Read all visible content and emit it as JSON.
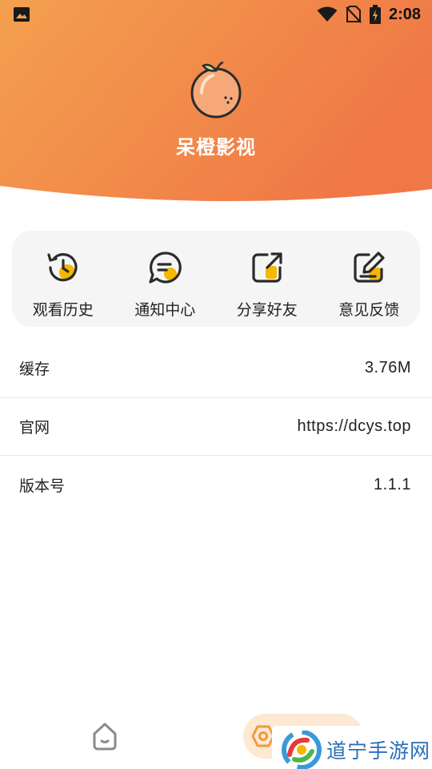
{
  "status_bar": {
    "time": "2:08",
    "icons": [
      "image-icon",
      "wifi-icon",
      "no-sim-icon",
      "battery-charging-icon"
    ]
  },
  "app": {
    "name": "呆橙影视",
    "logo_icon": "orange-fruit-icon"
  },
  "quick_actions": [
    {
      "label": "观看历史",
      "icon": "history-icon"
    },
    {
      "label": "通知中心",
      "icon": "message-icon"
    },
    {
      "label": "分享好友",
      "icon": "share-icon"
    },
    {
      "label": "意见反馈",
      "icon": "feedback-edit-icon"
    }
  ],
  "info_rows": [
    {
      "key": "缓存",
      "value": "3.76M"
    },
    {
      "key": "官网",
      "value": "https://dcys.top"
    },
    {
      "key": "版本号",
      "value": "1.1.1"
    }
  ],
  "bottom_nav": {
    "items": [
      {
        "icon": "home-icon",
        "active": false
      },
      {
        "icon": "profile-icon",
        "active": true
      }
    ]
  },
  "watermark": {
    "text": "道宁手游网"
  },
  "colors": {
    "header_gradient_start": "#f29a4d",
    "header_gradient_end": "#f07a48",
    "accent_yellow": "#f5b800",
    "icon_dark": "#2b2b2b",
    "card_bg": "#f5f5f5",
    "nav_active_bg": "#fde8d2"
  }
}
